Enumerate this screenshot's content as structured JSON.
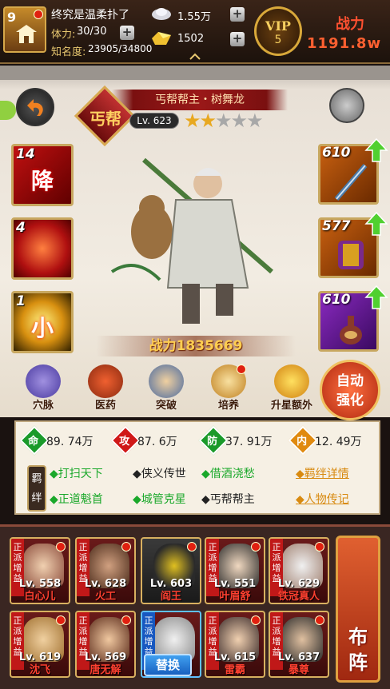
{
  "player": {
    "level": "9",
    "name": "终究是温柔扑了",
    "stamina_label": "体力:",
    "stamina_value": "30/30",
    "fame_label": "知名度:",
    "fame_value": "23905/34800"
  },
  "resources": {
    "silver": "1.55万",
    "gold": "1502"
  },
  "vip": {
    "label": "VIP",
    "level": "5"
  },
  "combat_power": {
    "label": "战力",
    "value": "1191.8w"
  },
  "hero": {
    "title": "丐帮帮主・树舞龙",
    "sect_badge": "丐帮",
    "level": "Lv. 623",
    "stars_total": 5,
    "stars_filled": 2,
    "power": "战力1835669"
  },
  "skills": [
    {
      "count": "14",
      "glyph": "降"
    },
    {
      "count": "4",
      "glyph": ""
    },
    {
      "count": "1",
      "glyph": "小"
    }
  ],
  "equipment": [
    {
      "level": "610"
    },
    {
      "level": "577"
    },
    {
      "level": "610"
    }
  ],
  "functions": [
    {
      "label": "穴脉"
    },
    {
      "label": "医药"
    },
    {
      "label": "突破"
    },
    {
      "label": "培养"
    },
    {
      "label": "升星额外"
    }
  ],
  "auto_button": {
    "line1": "自动",
    "line2": "强化"
  },
  "stats": [
    {
      "key": "命",
      "value": "89. 74万",
      "color": "#1a9a2a"
    },
    {
      "key": "攻",
      "value": "87. 6万",
      "color": "#d01818"
    },
    {
      "key": "防",
      "value": "37. 91万",
      "color": "#1a9a2a"
    },
    {
      "key": "内",
      "value": "12. 49万",
      "color": "#e08a10"
    }
  ],
  "fetters": {
    "tag": "羁绊",
    "items": [
      {
        "text": "◆打扫天下",
        "active": true
      },
      {
        "text": "◆侠义传世",
        "active": false
      },
      {
        "text": "◆借酒浇愁",
        "active": true
      },
      {
        "text": "◆正道魁首",
        "active": true
      },
      {
        "text": "◆城管克星",
        "active": true
      },
      {
        "text": "◆丐帮帮主",
        "active": false
      }
    ],
    "detail_link": "◆羁绊详情",
    "bio_link": "◆人物传记"
  },
  "roster": [
    {
      "tag": "正派增益",
      "level": "Lv. 558",
      "name": "白心儿"
    },
    {
      "tag": "正派增益",
      "level": "Lv. 628",
      "name": "火工"
    },
    {
      "tag": "",
      "level": "Lv. 603",
      "name": "阎王"
    },
    {
      "tag": "正派增益",
      "level": "Lv. 551",
      "name": "叶眉舒"
    },
    {
      "tag": "正派增益",
      "level": "Lv. 629",
      "name": "铁冠真人"
    },
    {
      "tag": "正派增益",
      "level": "Lv. 619",
      "name": "沈飞"
    },
    {
      "tag": "正派增益",
      "level": "Lv. 569",
      "name": "唐无解"
    },
    {
      "tag": "正派增益",
      "level": "",
      "name": ""
    },
    {
      "tag": "正派增益",
      "level": "Lv. 615",
      "name": "雷霸"
    },
    {
      "tag": "正派增益",
      "level": "Lv. 637",
      "name": "暴尊"
    }
  ],
  "swap_button": "替换",
  "formation": {
    "line1": "布",
    "line2": "阵"
  }
}
